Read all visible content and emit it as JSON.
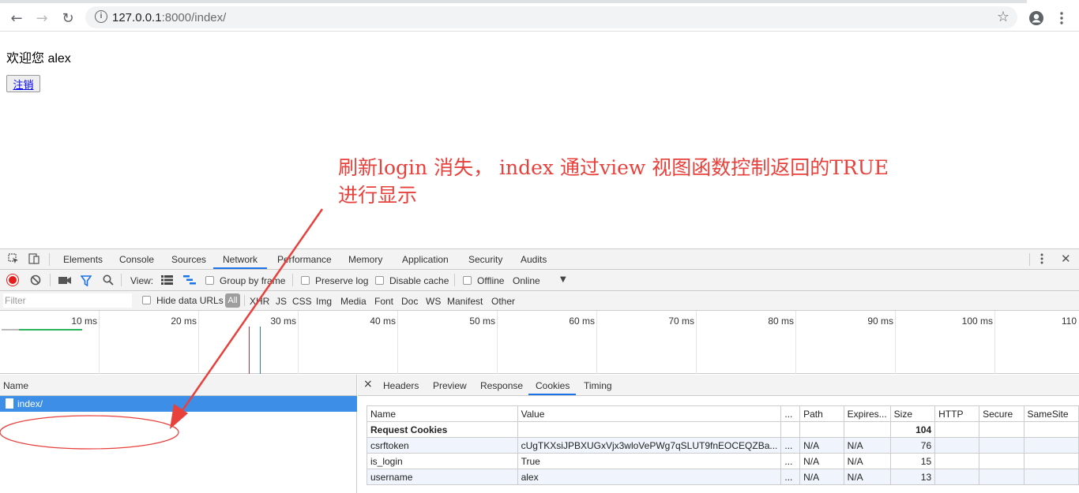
{
  "browser": {
    "url_host": "127.0.0.1",
    "url_path": ":8000/index/",
    "back_icon": "arrow-left",
    "forward_icon": "arrow-right",
    "reload_icon": "reload",
    "star_icon": "star",
    "account_icon": "account",
    "menu_icon": "kebab"
  },
  "page": {
    "welcome": "欢迎您 alex",
    "logout_label": "注销"
  },
  "annotation": {
    "line1": "刷新login 消失， index 通过view 视图函数控制返回的TRUE",
    "line2": "进行显示",
    "color": "#e8413c"
  },
  "devtools": {
    "tabs": [
      "Elements",
      "Console",
      "Sources",
      "Network",
      "Performance",
      "Memory",
      "Application",
      "Security",
      "Audits"
    ],
    "active_tab": "Network",
    "toolbar": {
      "view_label": "View:",
      "group_by_frame": "Group by frame",
      "preserve_log": "Preserve log",
      "disable_cache": "Disable cache",
      "offline": "Offline",
      "online": "Online"
    },
    "filter_bar": {
      "filter_placeholder": "Filter",
      "hide_data_urls": "Hide data URLs",
      "types": [
        "All",
        "XHR",
        "JS",
        "CSS",
        "Img",
        "Media",
        "Font",
        "Doc",
        "WS",
        "Manifest",
        "Other"
      ]
    },
    "timeline_ticks": [
      "10 ms",
      "20 ms",
      "30 ms",
      "40 ms",
      "50 ms",
      "60 ms",
      "70 ms",
      "80 ms",
      "90 ms",
      "100 ms",
      "110"
    ],
    "requests": {
      "header": "Name",
      "rows": [
        "index/"
      ]
    },
    "detail_tabs": [
      "Headers",
      "Preview",
      "Response",
      "Cookies",
      "Timing"
    ],
    "active_detail_tab": "Cookies",
    "cookies": {
      "columns": [
        "Name",
        "Value",
        "...",
        "Path",
        "Expires...",
        "Size",
        "HTTP",
        "Secure",
        "SameSite"
      ],
      "group_request": "Request Cookies",
      "group_request_size": "104",
      "rows": [
        {
          "name": "csrftoken",
          "value": "cUgTKXsiJPBXUGxVjx3wloVePWg7qSLUT9fnEOCEQZBa...",
          "dots": "...",
          "path": "N/A",
          "expires": "N/A",
          "size": "76"
        },
        {
          "name": "is_login",
          "value": "True",
          "dots": "...",
          "path": "N/A",
          "expires": "N/A",
          "size": "15"
        },
        {
          "name": "username",
          "value": "alex",
          "dots": "...",
          "path": "N/A",
          "expires": "N/A",
          "size": "13"
        }
      ]
    }
  }
}
